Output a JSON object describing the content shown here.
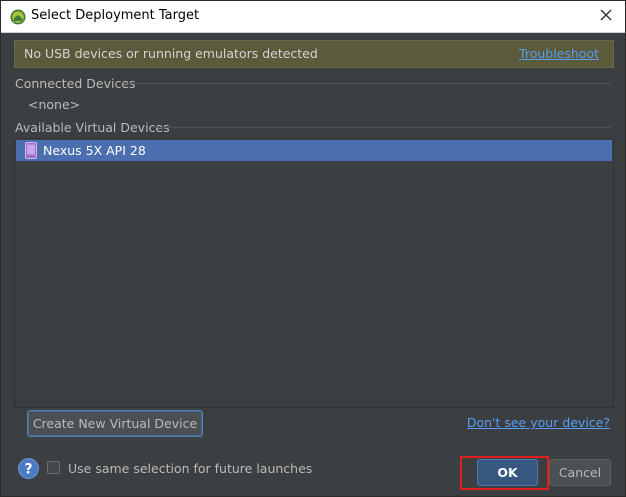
{
  "window": {
    "title": "Select Deployment Target"
  },
  "banner": {
    "message": "No USB devices or running emulators detected",
    "link": "Troubleshoot"
  },
  "connected": {
    "heading": "Connected Devices",
    "empty_text": "<none>"
  },
  "available": {
    "heading": "Available Virtual Devices",
    "devices": [
      {
        "label": "Nexus 5X API 28",
        "selected": true
      }
    ]
  },
  "actions": {
    "create_label": "Create New Virtual Device",
    "dont_see_label": "Don't see your device?",
    "remember_label": "Use same selection for future launches",
    "remember_checked": false,
    "ok_label": "OK",
    "cancel_label": "Cancel"
  },
  "icons": {
    "app": "android-studio-icon",
    "close": "close-icon",
    "device": "phone-icon",
    "help": "help-icon"
  }
}
